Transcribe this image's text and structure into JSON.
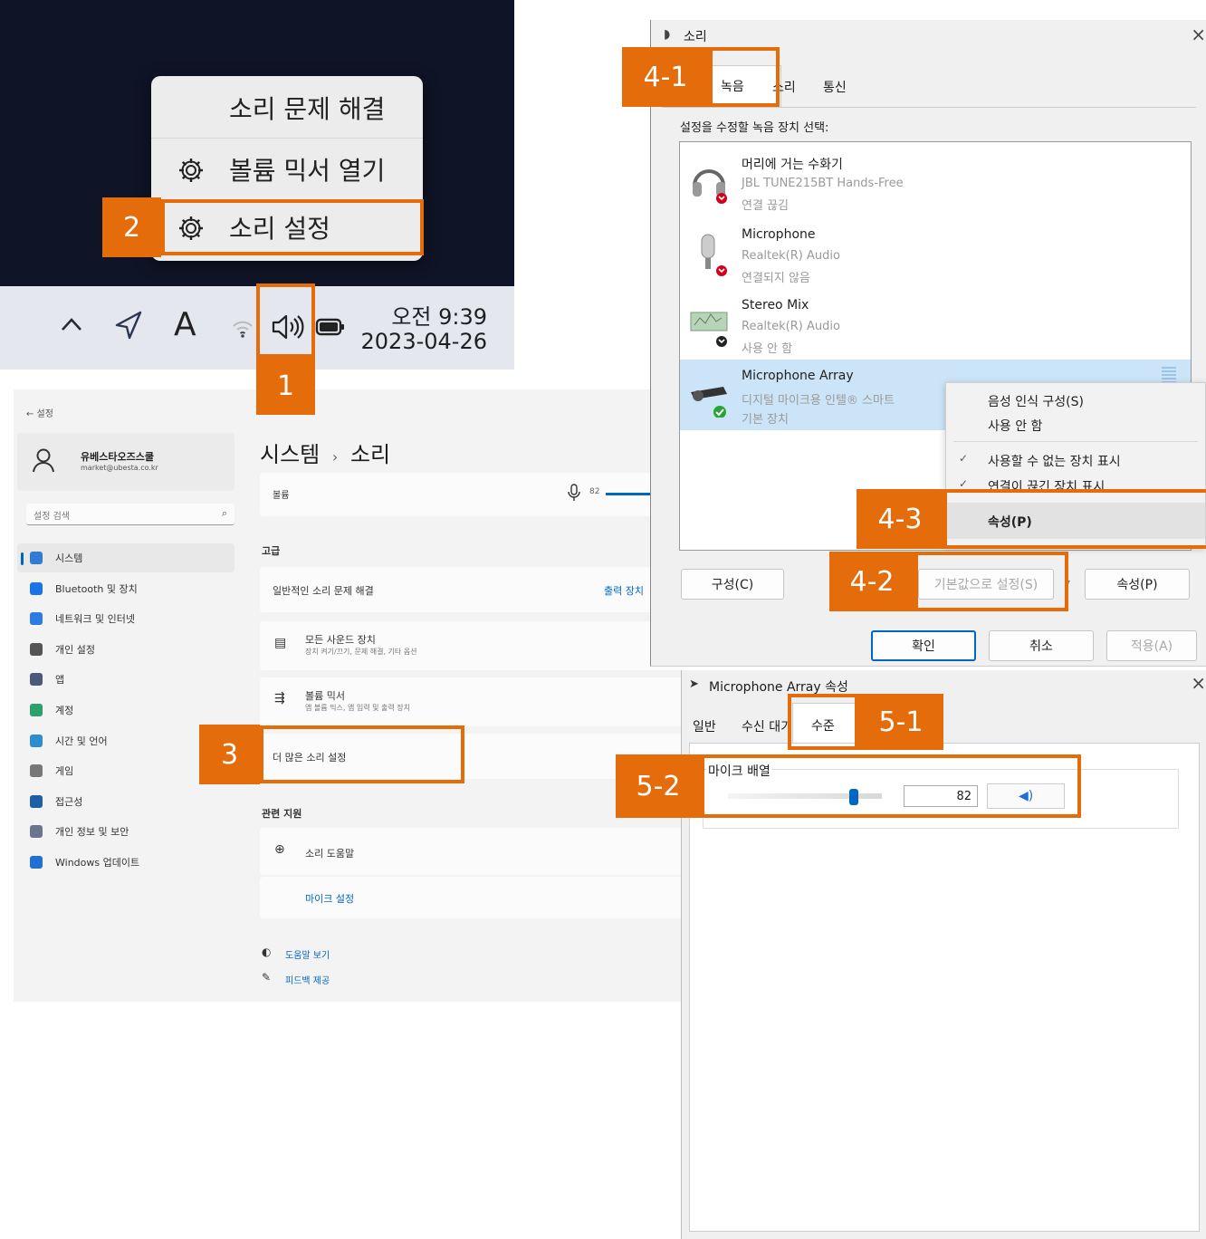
{
  "tray": {
    "menu": {
      "troubleshoot": "소리 문제 해결",
      "mixer": "볼륨 믹서 열기",
      "settings": "소리 설정"
    },
    "time": "오전 9:39",
    "date": "2023-04-26",
    "icons": [
      "chevron-up-icon",
      "location-icon",
      "input-indicator-icon",
      "wifi-icon",
      "volume-icon",
      "battery-icon"
    ],
    "input_letter": "A"
  },
  "settings": {
    "back_label": "← 설정",
    "user_name": "유베스타오즈스쿨",
    "user_email": "market@ubesta.co.kr",
    "search_placeholder": "설정 검색",
    "breadcrumb_parent": "시스템",
    "breadcrumb_sep": "›",
    "breadcrumb_current": "소리",
    "volume_label": "볼륨",
    "volume_value": "82",
    "advanced_header": "고급",
    "troubleshoot_label": "일반적인 소리 문제 해결",
    "troubleshoot_link": "출력 장치",
    "all_devices_title": "모든 사운드 장치",
    "all_devices_sub": "장치 켜기/끄기, 문제 해결, 기타 옵션",
    "mixer_title": "볼륨 믹서",
    "mixer_sub": "앱 볼륨 믹스, 앱 입력 및 출력 장치",
    "more_settings": "더 많은 소리 설정",
    "related_header": "관련 지원",
    "help_label": "소리 도움말",
    "mic_setup": "마이크 설정",
    "get_help": "도움말 보기",
    "feedback": "피드백 제공",
    "sidebar": [
      {
        "label": "시스템",
        "color": "#2f7bd6"
      },
      {
        "label": "Bluetooth 및 장치",
        "color": "#1a73e8"
      },
      {
        "label": "네트워크 및 인터넷",
        "color": "#2c7be5"
      },
      {
        "label": "개인 설정",
        "color": "#555"
      },
      {
        "label": "앱",
        "color": "#4a5a78"
      },
      {
        "label": "계정",
        "color": "#2aa36b"
      },
      {
        "label": "시간 및 언어",
        "color": "#2d8bd0"
      },
      {
        "label": "게임",
        "color": "#777"
      },
      {
        "label": "접근성",
        "color": "#1e5fa8"
      },
      {
        "label": "개인 정보 및 보안",
        "color": "#6a7590"
      },
      {
        "label": "Windows 업데이트",
        "color": "#1f6fd6"
      }
    ]
  },
  "sound_dialog": {
    "title": "소리",
    "tabs": [
      "녹음",
      "소리",
      "통신"
    ],
    "instruction": "설정을 수정할 녹음 장치 선택:",
    "devices": [
      {
        "name": "머리에 거는 수화기",
        "sub1": "JBL TUNE215BT Hands-Free",
        "sub2": "연결 끊김"
      },
      {
        "name": "Microphone",
        "sub1": "Realtek(R) Audio",
        "sub2": "연결되지 않음"
      },
      {
        "name": "Stereo Mix",
        "sub1": "Realtek(R) Audio",
        "sub2": "사용 안 함"
      },
      {
        "name": "Microphone Array",
        "sub1": "디지털 마이크용 인텔® 스마트",
        "sub2": "기본 장치"
      }
    ],
    "context_menu": [
      "음성 인식 구성(S)",
      "사용 안 함",
      "사용할 수 없는 장치 표시",
      "연결이 끊긴 장치 표시",
      "속성(P)"
    ],
    "configure_btn": "구성(C)",
    "set_default_btn": "기본값으로 설정(S)",
    "properties_btn": "속성(P)",
    "ok_btn": "확인",
    "cancel_btn": "취소",
    "apply_btn": "적용(A)"
  },
  "props_dialog": {
    "title": "Microphone Array 속성",
    "tabs": [
      "일반",
      "수신 대기",
      "수준"
    ],
    "level_label": "마이크 배열",
    "level_value": "82",
    "level_fraction": 0.82
  },
  "callouts": [
    "1",
    "2",
    "3",
    "4-1",
    "4-2",
    "4-3",
    "5-1",
    "5-2"
  ],
  "colors": {
    "accent": "#e46c0a",
    "select": "#cce4f7",
    "win_blue": "#0067c0"
  }
}
